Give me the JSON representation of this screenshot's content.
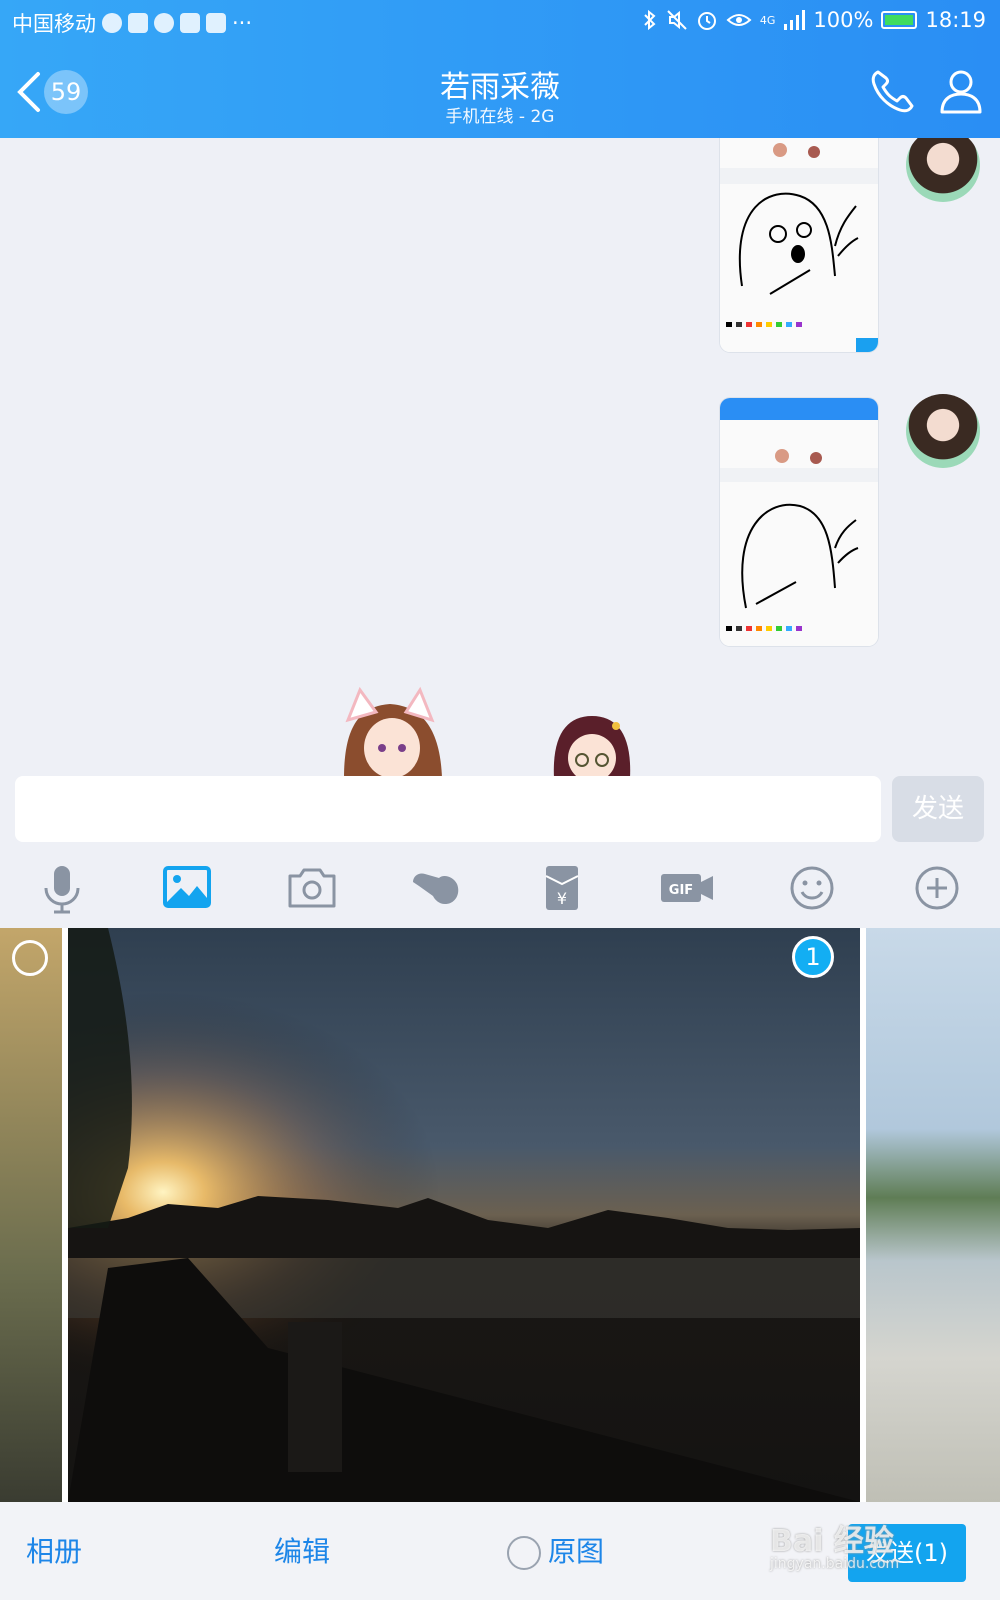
{
  "status_bar": {
    "carrier": "中国移动",
    "more": "···",
    "network": "4G",
    "battery": "100%",
    "time": "18:19"
  },
  "header": {
    "unread_count": "59",
    "contact_name": "若雨采薇",
    "contact_status": "手机在线 - 2G"
  },
  "composer": {
    "input_value": "",
    "send_label": "发送"
  },
  "toolbar": {
    "icons": [
      "mic-icon",
      "image-icon",
      "camera-icon",
      "poke-icon",
      "red-packet-icon",
      "gif-icon",
      "emoji-icon",
      "plus-icon"
    ]
  },
  "photos": {
    "selected_index_label": "1"
  },
  "bottom_bar": {
    "album_label": "相册",
    "edit_label": "编辑",
    "original_label": "原图",
    "send_label": "发送(1)"
  },
  "watermark": {
    "brand": "Bai 经验",
    "url": "jingyan.baidu.com"
  },
  "colors": {
    "header_blue": "#2a8ef4",
    "accent_blue": "#13a4ef",
    "link_blue": "#1d86e8"
  }
}
